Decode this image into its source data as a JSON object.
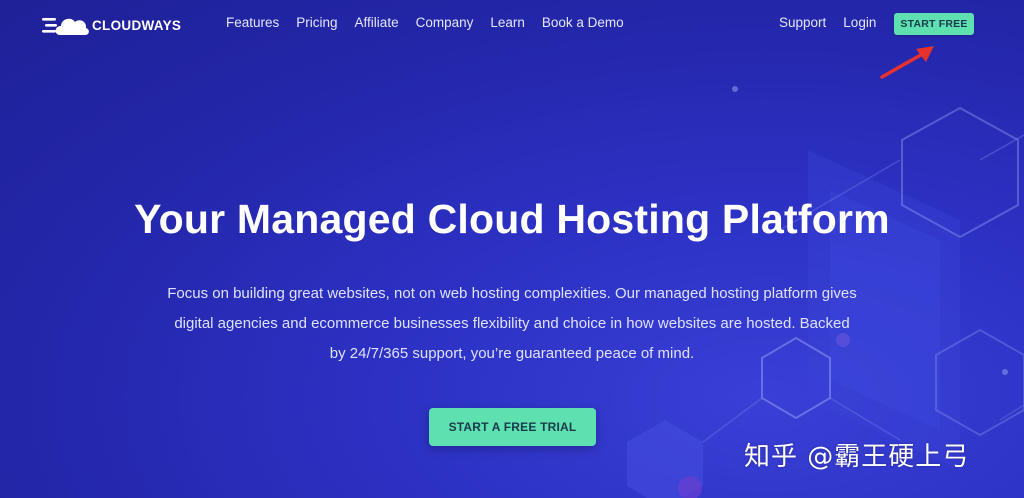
{
  "brand": {
    "name": "CLOUDWAYS",
    "logo_icon": "cloud-icon"
  },
  "nav": {
    "links": [
      "Features",
      "Pricing",
      "Affiliate",
      "Company",
      "Learn",
      "Book a Demo"
    ],
    "right_links": [
      "Support",
      "Login"
    ],
    "cta_label": "START FREE"
  },
  "hero": {
    "title": "Your Managed Cloud Hosting Platform",
    "subtitle_lines": [
      "Focus on building great websites, not on web hosting complexities. Our managed hosting platform gives",
      "digital agencies and ecommerce businesses flexibility and choice in how websites are hosted. Backed",
      "by 24/7/365 support, you’re guaranteed peace of mind."
    ],
    "cta_label": "START A FREE TRIAL"
  },
  "annotation": {
    "arrow_icon": "red-arrow-icon",
    "color": "#e8312c"
  },
  "watermark": {
    "text": "知乎 @霸王硬上弓"
  },
  "colors": {
    "background": "#2326a8",
    "accent": "#5ee0b1",
    "button_text": "#183a4a"
  }
}
